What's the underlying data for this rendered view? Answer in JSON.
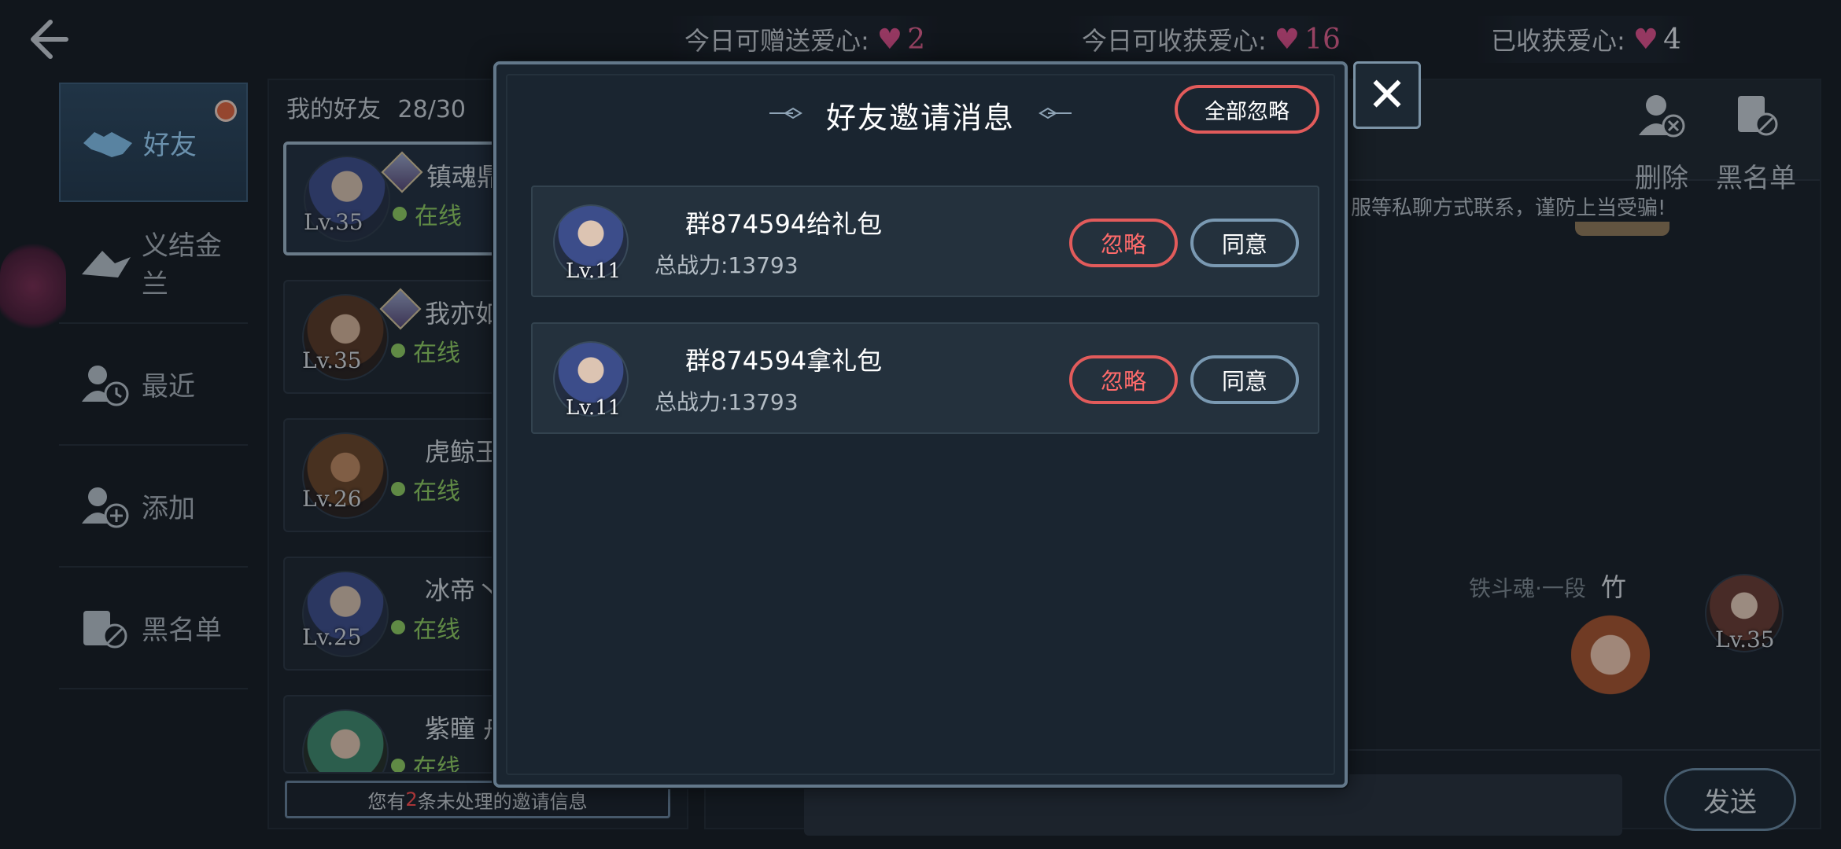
{
  "top_stats": {
    "give_label": "今日可赠送爱心:",
    "give_value": "2",
    "receive_label": "今日可收获爱心:",
    "receive_value": "16",
    "collected_label": "已收获爱心:",
    "collected_value": "4",
    "heart": "♥"
  },
  "nav": {
    "items": [
      {
        "label": "好友",
        "icon": "handshake-icon"
      },
      {
        "label": "义结金兰",
        "icon": "bond-icon"
      },
      {
        "label": "最近",
        "icon": "recent-icon"
      },
      {
        "label": "添加",
        "icon": "add-friend-icon"
      },
      {
        "label": "黑名单",
        "icon": "blacklist-icon"
      }
    ]
  },
  "friends": {
    "header": "我的好友",
    "count": "28/30",
    "list": [
      {
        "name": "镇魂鼎",
        "status": "在线",
        "level": "Lv.35"
      },
      {
        "name": "我亦如",
        "status": "在线",
        "level": "Lv.35"
      },
      {
        "name": "虎鲸王",
        "status": "在线",
        "level": "Lv.26"
      },
      {
        "name": "冰帝丶",
        "status": "在线",
        "level": "Lv.25"
      },
      {
        "name": "紫瞳 舟",
        "status": "在线",
        "level": ""
      }
    ],
    "pending_prefix": "您有",
    "pending_count": "2",
    "pending_suffix": "条未处理的邀请信息"
  },
  "chat": {
    "delete_label": "删除",
    "blacklist_label": "黑名单",
    "notice": "服等私聊方式联系，谨防上当受骗!",
    "user_title": "铁斗魂·一段",
    "user_name": "竹",
    "user_level": "Lv.35",
    "send_label": "发送"
  },
  "modal": {
    "title": "好友邀请消息",
    "ignore_all": "全部忽略",
    "close": "✕",
    "invites": [
      {
        "name": "群874594给礼包",
        "power": "总战力:13793",
        "level": "Lv.11",
        "ignore": "忽略",
        "accept": "同意"
      },
      {
        "name": "群874594拿礼包",
        "power": "总战力:13793",
        "level": "Lv.11",
        "ignore": "忽略",
        "accept": "同意"
      }
    ]
  }
}
